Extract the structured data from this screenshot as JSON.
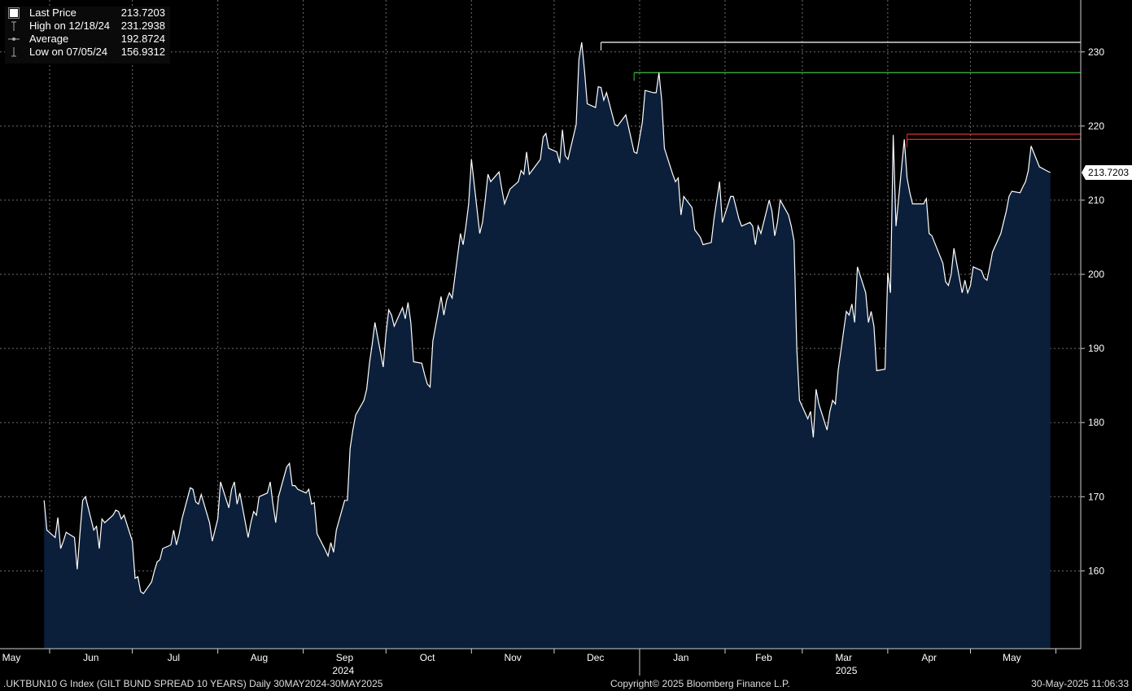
{
  "legend": {
    "last_price_label": "Last Price",
    "last_price_value": "213.7203",
    "high_label": "High on 12/18/24",
    "high_value": "231.2938",
    "average_label": "Average",
    "average_value": "192.8724",
    "low_label": "Low on 07/05/24",
    "low_value": "156.9312"
  },
  "footer": {
    "left": ".UKTBUN10 G Index (GILT BUND SPREAD 10 YEARS)  Daily 30MAY2024-30MAY2025",
    "center": "Copyright© 2025 Bloomberg Finance L.P.",
    "right": "30-May-2025 11:06:33"
  },
  "colors": {
    "area_fill": "#0b1f3a",
    "line": "#ffffff",
    "grid": "#6e6e6e",
    "high_line": "#ffffff",
    "green_line": "#3fbf3f",
    "red_line": "#e03030"
  },
  "chart_data": {
    "type": "area",
    "title": "",
    "xlabel": "",
    "ylabel": "",
    "ylim": [
      149.5,
      237
    ],
    "yticks": [
      160,
      170,
      180,
      190,
      200,
      210,
      220,
      230
    ],
    "grid": true,
    "legend_position": "top-left",
    "last_value_label": "213.7203",
    "x_tick_labels": [
      "May",
      "Jun",
      "Jul",
      "Aug",
      "Sep",
      "Oct",
      "Nov",
      "Dec",
      "Jan",
      "Feb",
      "Mar",
      "Apr",
      "May"
    ],
    "x_year_labels": [
      "2024",
      "2025"
    ],
    "reference_lines": [
      {
        "name": "high",
        "value": 231.29,
        "color": "#ffffff",
        "from": "2024-12-18"
      },
      {
        "name": "green",
        "value": 227.2,
        "color": "#3fbf3f",
        "from": "2024-12-30"
      },
      {
        "name": "red-upper",
        "value": 218.9,
        "color": "#e03030",
        "from": "2025-04-08"
      },
      {
        "name": "red-lower",
        "value": 218.2,
        "color": "#e03030",
        "from": "2025-04-08"
      }
    ],
    "series": [
      {
        "name": "Last Price",
        "points": [
          [
            "2024-05-30",
            169.5
          ],
          [
            "2024-05-31",
            165.5
          ],
          [
            "2024-06-03",
            164.5
          ],
          [
            "2024-06-04",
            167.2
          ],
          [
            "2024-06-05",
            163.0
          ],
          [
            "2024-06-06",
            164.0
          ],
          [
            "2024-06-07",
            165.2
          ],
          [
            "2024-06-10",
            164.5
          ],
          [
            "2024-06-11",
            160.2
          ],
          [
            "2024-06-12",
            165.0
          ],
          [
            "2024-06-13",
            169.5
          ],
          [
            "2024-06-14",
            170.0
          ],
          [
            "2024-06-17",
            165.5
          ],
          [
            "2024-06-18",
            166.0
          ],
          [
            "2024-06-19",
            163.0
          ],
          [
            "2024-06-20",
            167.0
          ],
          [
            "2024-06-21",
            166.5
          ],
          [
            "2024-06-24",
            167.5
          ],
          [
            "2024-06-25",
            168.2
          ],
          [
            "2024-06-26",
            168.0
          ],
          [
            "2024-06-27",
            167.0
          ],
          [
            "2024-06-28",
            167.5
          ],
          [
            "2024-07-01",
            164.0
          ],
          [
            "2024-07-02",
            159.0
          ],
          [
            "2024-07-03",
            159.2
          ],
          [
            "2024-07-04",
            157.2
          ],
          [
            "2024-07-05",
            156.93
          ],
          [
            "2024-07-08",
            158.5
          ],
          [
            "2024-07-09",
            160.0
          ],
          [
            "2024-07-10",
            161.2
          ],
          [
            "2024-07-11",
            161.5
          ],
          [
            "2024-07-12",
            163.0
          ],
          [
            "2024-07-15",
            163.5
          ],
          [
            "2024-07-16",
            165.5
          ],
          [
            "2024-07-17",
            163.5
          ],
          [
            "2024-07-18",
            165.0
          ],
          [
            "2024-07-19",
            167.0
          ],
          [
            "2024-07-22",
            171.2
          ],
          [
            "2024-07-23",
            171.0
          ],
          [
            "2024-07-24",
            169.3
          ],
          [
            "2024-07-25",
            169.0
          ],
          [
            "2024-07-26",
            170.3
          ],
          [
            "2024-07-29",
            166.5
          ],
          [
            "2024-07-30",
            164.0
          ],
          [
            "2024-07-31",
            165.5
          ],
          [
            "2024-08-01",
            167.0
          ],
          [
            "2024-08-02",
            172.0
          ],
          [
            "2024-08-05",
            168.5
          ],
          [
            "2024-08-06",
            171.0
          ],
          [
            "2024-08-07",
            172.0
          ],
          [
            "2024-08-08",
            169.0
          ],
          [
            "2024-08-09",
            170.5
          ],
          [
            "2024-08-12",
            164.5
          ],
          [
            "2024-08-13",
            166.5
          ],
          [
            "2024-08-14",
            168.0
          ],
          [
            "2024-08-15",
            167.5
          ],
          [
            "2024-08-16",
            170.0
          ],
          [
            "2024-08-19",
            170.5
          ],
          [
            "2024-08-20",
            172.0
          ],
          [
            "2024-08-21",
            169.0
          ],
          [
            "2024-08-22",
            166.5
          ],
          [
            "2024-08-23",
            170.0
          ],
          [
            "2024-08-26",
            174.0
          ],
          [
            "2024-08-27",
            174.5
          ],
          [
            "2024-08-28",
            171.5
          ],
          [
            "2024-08-29",
            171.5
          ],
          [
            "2024-08-30",
            171.0
          ],
          [
            "2024-09-02",
            170.5
          ],
          [
            "2024-09-03",
            171.0
          ],
          [
            "2024-09-04",
            169.0
          ],
          [
            "2024-09-05",
            169.2
          ],
          [
            "2024-09-06",
            165.0
          ],
          [
            "2024-09-09",
            162.8
          ],
          [
            "2024-09-10",
            162.0
          ],
          [
            "2024-09-11",
            163.8
          ],
          [
            "2024-09-12",
            162.5
          ],
          [
            "2024-09-13",
            165.5
          ],
          [
            "2024-09-16",
            169.5
          ],
          [
            "2024-09-17",
            169.5
          ],
          [
            "2024-09-18",
            176.5
          ],
          [
            "2024-09-19",
            179.0
          ],
          [
            "2024-09-20",
            181.0
          ],
          [
            "2024-09-23",
            183.0
          ],
          [
            "2024-09-24",
            184.5
          ],
          [
            "2024-09-25",
            188.0
          ],
          [
            "2024-09-26",
            190.5
          ],
          [
            "2024-09-27",
            193.5
          ],
          [
            "2024-09-30",
            187.5
          ],
          [
            "2024-10-01",
            192.0
          ],
          [
            "2024-10-02",
            195.2
          ],
          [
            "2024-10-03",
            194.5
          ],
          [
            "2024-10-04",
            193.0
          ],
          [
            "2024-10-07",
            195.5
          ],
          [
            "2024-10-08",
            194.0
          ],
          [
            "2024-10-09",
            196.2
          ],
          [
            "2024-10-10",
            193.5
          ],
          [
            "2024-10-11",
            188.2
          ],
          [
            "2024-10-14",
            188.0
          ],
          [
            "2024-10-15",
            186.5
          ],
          [
            "2024-10-16",
            185.2
          ],
          [
            "2024-10-17",
            184.8
          ],
          [
            "2024-10-18",
            191.0
          ],
          [
            "2024-10-21",
            197.0
          ],
          [
            "2024-10-22",
            194.5
          ],
          [
            "2024-10-23",
            196.5
          ],
          [
            "2024-10-24",
            197.5
          ],
          [
            "2024-10-25",
            196.8
          ],
          [
            "2024-10-28",
            205.5
          ],
          [
            "2024-10-29",
            204.0
          ],
          [
            "2024-10-30",
            206.5
          ],
          [
            "2024-10-31",
            209.5
          ],
          [
            "2024-11-01",
            215.5
          ],
          [
            "2024-11-04",
            205.5
          ],
          [
            "2024-11-05",
            207.0
          ],
          [
            "2024-11-06",
            210.0
          ],
          [
            "2024-11-07",
            213.5
          ],
          [
            "2024-11-08",
            212.5
          ],
          [
            "2024-11-11",
            213.8
          ],
          [
            "2024-11-12",
            211.5
          ],
          [
            "2024-11-13",
            209.5
          ],
          [
            "2024-11-14",
            210.5
          ],
          [
            "2024-11-15",
            211.5
          ],
          [
            "2024-11-18",
            212.5
          ],
          [
            "2024-11-19",
            214.0
          ],
          [
            "2024-11-20",
            213.5
          ],
          [
            "2024-11-21",
            216.5
          ],
          [
            "2024-11-22",
            213.5
          ],
          [
            "2024-11-25",
            215.0
          ],
          [
            "2024-11-26",
            215.5
          ],
          [
            "2024-11-27",
            218.5
          ],
          [
            "2024-11-28",
            219.0
          ],
          [
            "2024-11-29",
            217.0
          ],
          [
            "2024-12-02",
            216.5
          ],
          [
            "2024-12-03",
            215.0
          ],
          [
            "2024-12-04",
            219.5
          ],
          [
            "2024-12-05",
            216.0
          ],
          [
            "2024-12-06",
            215.5
          ],
          [
            "2024-12-09",
            220.2
          ],
          [
            "2024-12-10",
            229.0
          ],
          [
            "2024-12-11",
            231.29
          ],
          [
            "2024-12-12",
            227.5
          ],
          [
            "2024-12-13",
            223.0
          ],
          [
            "2024-12-16",
            222.5
          ],
          [
            "2024-12-17",
            225.3
          ],
          [
            "2024-12-18",
            225.2
          ],
          [
            "2024-12-19",
            223.5
          ],
          [
            "2024-12-20",
            224.5
          ],
          [
            "2024-12-23",
            220.2
          ],
          [
            "2024-12-24",
            220.0
          ],
          [
            "2024-12-27",
            221.5
          ],
          [
            "2024-12-30",
            216.5
          ],
          [
            "2024-12-31",
            216.3
          ],
          [
            "2025-01-02",
            220.5
          ],
          [
            "2025-01-03",
            224.8
          ],
          [
            "2025-01-06",
            224.5
          ],
          [
            "2025-01-07",
            224.5
          ],
          [
            "2025-01-08",
            227.2
          ],
          [
            "2025-01-09",
            223.5
          ],
          [
            "2025-01-10",
            217.0
          ],
          [
            "2025-01-13",
            213.5
          ],
          [
            "2025-01-14",
            212.5
          ],
          [
            "2025-01-15",
            213.0
          ],
          [
            "2025-01-16",
            208.0
          ],
          [
            "2025-01-17",
            210.5
          ],
          [
            "2025-01-20",
            209.0
          ],
          [
            "2025-01-21",
            206.0
          ],
          [
            "2025-01-22",
            205.5
          ],
          [
            "2025-01-23",
            205.0
          ],
          [
            "2025-01-24",
            204.0
          ],
          [
            "2025-01-27",
            204.3
          ],
          [
            "2025-01-28",
            207.5
          ],
          [
            "2025-01-29",
            210.0
          ],
          [
            "2025-01-30",
            212.5
          ],
          [
            "2025-01-31",
            207.0
          ],
          [
            "2025-02-03",
            210.5
          ],
          [
            "2025-02-04",
            210.5
          ],
          [
            "2025-02-05",
            209.0
          ],
          [
            "2025-02-06",
            207.5
          ],
          [
            "2025-02-07",
            206.5
          ],
          [
            "2025-02-10",
            207.0
          ],
          [
            "2025-02-11",
            206.5
          ],
          [
            "2025-02-12",
            204.0
          ],
          [
            "2025-02-13",
            206.5
          ],
          [
            "2025-02-14",
            205.5
          ],
          [
            "2025-02-17",
            210.0
          ],
          [
            "2025-02-18",
            208.5
          ],
          [
            "2025-02-19",
            205.2
          ],
          [
            "2025-02-20",
            207.0
          ],
          [
            "2025-02-21",
            210.0
          ],
          [
            "2025-02-24",
            208.0
          ],
          [
            "2025-02-25",
            206.5
          ],
          [
            "2025-02-26",
            204.5
          ],
          [
            "2025-02-27",
            190.0
          ],
          [
            "2025-02-28",
            183.0
          ],
          [
            "2025-03-03",
            180.5
          ],
          [
            "2025-03-04",
            181.5
          ],
          [
            "2025-03-05",
            178.0
          ],
          [
            "2025-03-06",
            184.5
          ],
          [
            "2025-03-07",
            182.5
          ],
          [
            "2025-03-10",
            179.0
          ],
          [
            "2025-03-11",
            181.5
          ],
          [
            "2025-03-12",
            183.0
          ],
          [
            "2025-03-13",
            182.5
          ],
          [
            "2025-03-14",
            187.0
          ],
          [
            "2025-03-17",
            195.0
          ],
          [
            "2025-03-18",
            194.5
          ],
          [
            "2025-03-19",
            196.0
          ],
          [
            "2025-03-20",
            193.5
          ],
          [
            "2025-03-21",
            201.0
          ],
          [
            "2025-03-24",
            197.5
          ],
          [
            "2025-03-25",
            193.5
          ],
          [
            "2025-03-26",
            195.0
          ],
          [
            "2025-03-27",
            193.0
          ],
          [
            "2025-03-28",
            187.0
          ],
          [
            "2025-03-31",
            187.2
          ],
          [
            "2025-04-01",
            200.2
          ],
          [
            "2025-04-02",
            197.5
          ],
          [
            "2025-04-03",
            218.8
          ],
          [
            "2025-04-04",
            206.5
          ],
          [
            "2025-04-07",
            218.2
          ],
          [
            "2025-04-08",
            213.0
          ],
          [
            "2025-04-09",
            211.0
          ],
          [
            "2025-04-10",
            209.5
          ],
          [
            "2025-04-11",
            209.5
          ],
          [
            "2025-04-14",
            209.5
          ],
          [
            "2025-04-15",
            210.2
          ],
          [
            "2025-04-16",
            205.5
          ],
          [
            "2025-04-17",
            205.2
          ],
          [
            "2025-04-21",
            201.5
          ],
          [
            "2025-04-22",
            199.0
          ],
          [
            "2025-04-23",
            198.5
          ],
          [
            "2025-04-24",
            200.0
          ],
          [
            "2025-04-25",
            203.5
          ],
          [
            "2025-04-28",
            197.5
          ],
          [
            "2025-04-29",
            199.2
          ],
          [
            "2025-04-30",
            197.5
          ],
          [
            "2025-05-01",
            198.5
          ],
          [
            "2025-05-02",
            201.0
          ],
          [
            "2025-05-05",
            200.5
          ],
          [
            "2025-05-06",
            199.5
          ],
          [
            "2025-05-07",
            199.2
          ],
          [
            "2025-05-08",
            201.0
          ],
          [
            "2025-05-09",
            203.0
          ],
          [
            "2025-05-12",
            205.5
          ],
          [
            "2025-05-13",
            207.0
          ],
          [
            "2025-05-14",
            208.5
          ],
          [
            "2025-05-15",
            210.5
          ],
          [
            "2025-05-16",
            211.2
          ],
          [
            "2025-05-19",
            211.0
          ],
          [
            "2025-05-20",
            211.8
          ],
          [
            "2025-05-21",
            212.5
          ],
          [
            "2025-05-22",
            214.0
          ],
          [
            "2025-05-23",
            217.3
          ],
          [
            "2025-05-26",
            214.5
          ],
          [
            "2025-05-29",
            213.9
          ],
          [
            "2025-05-30",
            213.72
          ]
        ]
      }
    ]
  }
}
